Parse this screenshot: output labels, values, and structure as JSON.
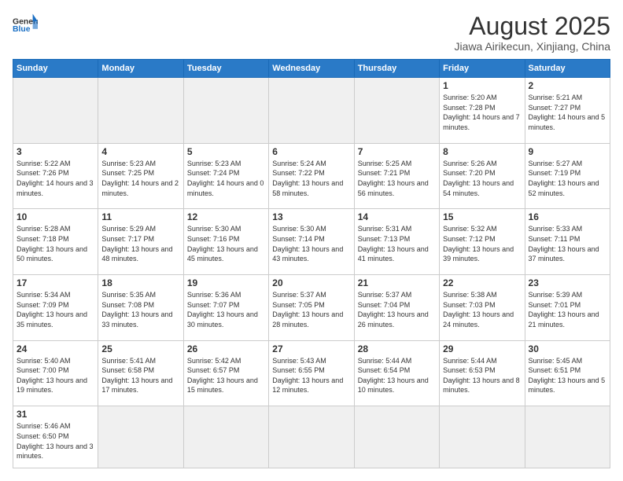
{
  "header": {
    "logo_general": "General",
    "logo_blue": "Blue",
    "title": "August 2025",
    "subtitle": "Jiawa Airikecun, Xinjiang, China"
  },
  "weekdays": [
    "Sunday",
    "Monday",
    "Tuesday",
    "Wednesday",
    "Thursday",
    "Friday",
    "Saturday"
  ],
  "weeks": [
    [
      {
        "num": "",
        "info": "",
        "empty": true
      },
      {
        "num": "",
        "info": "",
        "empty": true
      },
      {
        "num": "",
        "info": "",
        "empty": true
      },
      {
        "num": "",
        "info": "",
        "empty": true
      },
      {
        "num": "",
        "info": "",
        "empty": true
      },
      {
        "num": "1",
        "info": "Sunrise: 5:20 AM\nSunset: 7:28 PM\nDaylight: 14 hours\nand 7 minutes.",
        "empty": false
      },
      {
        "num": "2",
        "info": "Sunrise: 5:21 AM\nSunset: 7:27 PM\nDaylight: 14 hours\nand 5 minutes.",
        "empty": false
      }
    ],
    [
      {
        "num": "3",
        "info": "Sunrise: 5:22 AM\nSunset: 7:26 PM\nDaylight: 14 hours\nand 3 minutes.",
        "empty": false
      },
      {
        "num": "4",
        "info": "Sunrise: 5:23 AM\nSunset: 7:25 PM\nDaylight: 14 hours\nand 2 minutes.",
        "empty": false
      },
      {
        "num": "5",
        "info": "Sunrise: 5:23 AM\nSunset: 7:24 PM\nDaylight: 14 hours\nand 0 minutes.",
        "empty": false
      },
      {
        "num": "6",
        "info": "Sunrise: 5:24 AM\nSunset: 7:22 PM\nDaylight: 13 hours\nand 58 minutes.",
        "empty": false
      },
      {
        "num": "7",
        "info": "Sunrise: 5:25 AM\nSunset: 7:21 PM\nDaylight: 13 hours\nand 56 minutes.",
        "empty": false
      },
      {
        "num": "8",
        "info": "Sunrise: 5:26 AM\nSunset: 7:20 PM\nDaylight: 13 hours\nand 54 minutes.",
        "empty": false
      },
      {
        "num": "9",
        "info": "Sunrise: 5:27 AM\nSunset: 7:19 PM\nDaylight: 13 hours\nand 52 minutes.",
        "empty": false
      }
    ],
    [
      {
        "num": "10",
        "info": "Sunrise: 5:28 AM\nSunset: 7:18 PM\nDaylight: 13 hours\nand 50 minutes.",
        "empty": false
      },
      {
        "num": "11",
        "info": "Sunrise: 5:29 AM\nSunset: 7:17 PM\nDaylight: 13 hours\nand 48 minutes.",
        "empty": false
      },
      {
        "num": "12",
        "info": "Sunrise: 5:30 AM\nSunset: 7:16 PM\nDaylight: 13 hours\nand 45 minutes.",
        "empty": false
      },
      {
        "num": "13",
        "info": "Sunrise: 5:30 AM\nSunset: 7:14 PM\nDaylight: 13 hours\nand 43 minutes.",
        "empty": false
      },
      {
        "num": "14",
        "info": "Sunrise: 5:31 AM\nSunset: 7:13 PM\nDaylight: 13 hours\nand 41 minutes.",
        "empty": false
      },
      {
        "num": "15",
        "info": "Sunrise: 5:32 AM\nSunset: 7:12 PM\nDaylight: 13 hours\nand 39 minutes.",
        "empty": false
      },
      {
        "num": "16",
        "info": "Sunrise: 5:33 AM\nSunset: 7:11 PM\nDaylight: 13 hours\nand 37 minutes.",
        "empty": false
      }
    ],
    [
      {
        "num": "17",
        "info": "Sunrise: 5:34 AM\nSunset: 7:09 PM\nDaylight: 13 hours\nand 35 minutes.",
        "empty": false
      },
      {
        "num": "18",
        "info": "Sunrise: 5:35 AM\nSunset: 7:08 PM\nDaylight: 13 hours\nand 33 minutes.",
        "empty": false
      },
      {
        "num": "19",
        "info": "Sunrise: 5:36 AM\nSunset: 7:07 PM\nDaylight: 13 hours\nand 30 minutes.",
        "empty": false
      },
      {
        "num": "20",
        "info": "Sunrise: 5:37 AM\nSunset: 7:05 PM\nDaylight: 13 hours\nand 28 minutes.",
        "empty": false
      },
      {
        "num": "21",
        "info": "Sunrise: 5:37 AM\nSunset: 7:04 PM\nDaylight: 13 hours\nand 26 minutes.",
        "empty": false
      },
      {
        "num": "22",
        "info": "Sunrise: 5:38 AM\nSunset: 7:03 PM\nDaylight: 13 hours\nand 24 minutes.",
        "empty": false
      },
      {
        "num": "23",
        "info": "Sunrise: 5:39 AM\nSunset: 7:01 PM\nDaylight: 13 hours\nand 21 minutes.",
        "empty": false
      }
    ],
    [
      {
        "num": "24",
        "info": "Sunrise: 5:40 AM\nSunset: 7:00 PM\nDaylight: 13 hours\nand 19 minutes.",
        "empty": false
      },
      {
        "num": "25",
        "info": "Sunrise: 5:41 AM\nSunset: 6:58 PM\nDaylight: 13 hours\nand 17 minutes.",
        "empty": false
      },
      {
        "num": "26",
        "info": "Sunrise: 5:42 AM\nSunset: 6:57 PM\nDaylight: 13 hours\nand 15 minutes.",
        "empty": false
      },
      {
        "num": "27",
        "info": "Sunrise: 5:43 AM\nSunset: 6:55 PM\nDaylight: 13 hours\nand 12 minutes.",
        "empty": false
      },
      {
        "num": "28",
        "info": "Sunrise: 5:44 AM\nSunset: 6:54 PM\nDaylight: 13 hours\nand 10 minutes.",
        "empty": false
      },
      {
        "num": "29",
        "info": "Sunrise: 5:44 AM\nSunset: 6:53 PM\nDaylight: 13 hours\nand 8 minutes.",
        "empty": false
      },
      {
        "num": "30",
        "info": "Sunrise: 5:45 AM\nSunset: 6:51 PM\nDaylight: 13 hours\nand 5 minutes.",
        "empty": false
      }
    ],
    [
      {
        "num": "31",
        "info": "Sunrise: 5:46 AM\nSunset: 6:50 PM\nDaylight: 13 hours\nand 3 minutes.",
        "empty": false
      },
      {
        "num": "",
        "info": "",
        "empty": true
      },
      {
        "num": "",
        "info": "",
        "empty": true
      },
      {
        "num": "",
        "info": "",
        "empty": true
      },
      {
        "num": "",
        "info": "",
        "empty": true
      },
      {
        "num": "",
        "info": "",
        "empty": true
      },
      {
        "num": "",
        "info": "",
        "empty": true
      }
    ]
  ]
}
